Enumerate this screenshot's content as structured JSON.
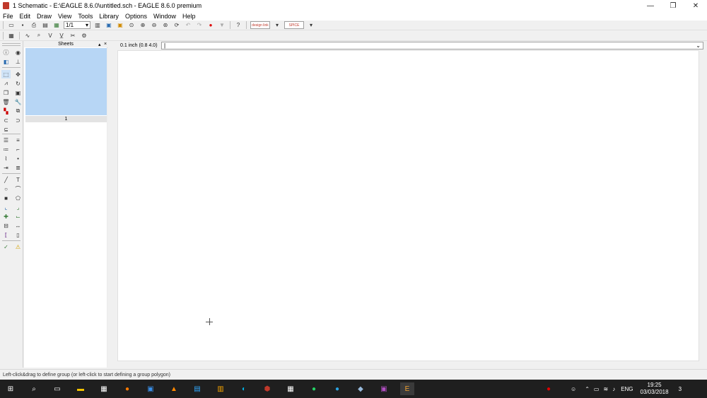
{
  "window": {
    "title": "1 Schematic - E:\\EAGLE 8.6.0\\untitled.sch - EAGLE 8.6.0 premium",
    "minimize": "—",
    "restore": "❐",
    "close": "✕"
  },
  "menu": [
    "File",
    "Edit",
    "Draw",
    "View",
    "Tools",
    "Library",
    "Options",
    "Window",
    "Help"
  ],
  "toolbar": {
    "sheet_value": "1/1",
    "badge1": "design link",
    "badge2": "SPICE"
  },
  "panel": {
    "title": "Sheets",
    "pin": "▴",
    "close": "×",
    "sheet_number": "1"
  },
  "coord": {
    "readout": "0.1 inch (0.8 4.0)",
    "command_value": "|"
  },
  "status": {
    "message": "Left-click&drag to define group (or left-click to start defining a group polygon)"
  },
  "taskbar": {
    "language": "ENG",
    "time": "19:25",
    "date": "03/03/2018",
    "notifications": "3"
  }
}
